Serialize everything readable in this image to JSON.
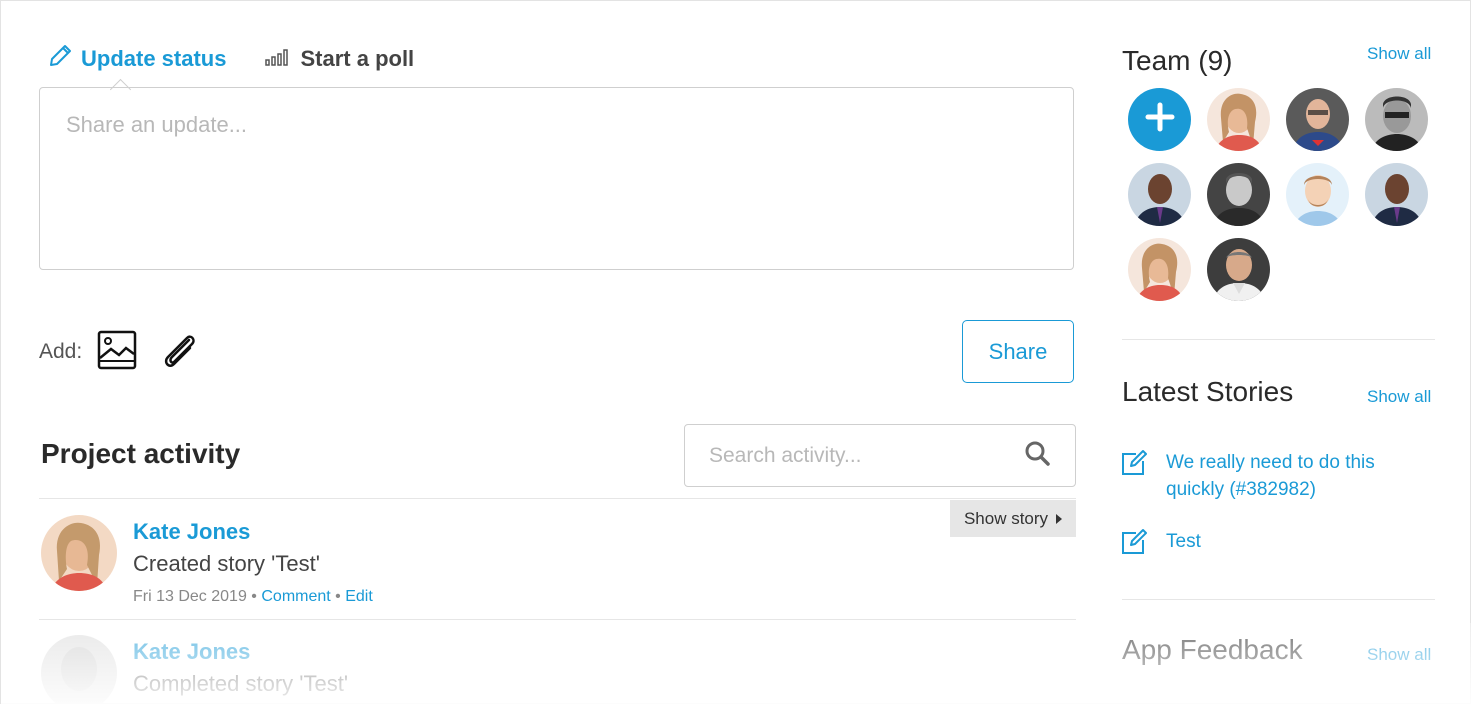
{
  "tabs": {
    "update_label": "Update status",
    "poll_label": "Start a poll"
  },
  "composer": {
    "placeholder": "Share an update...",
    "add_label": "Add:",
    "share_label": "Share"
  },
  "activity": {
    "title": "Project activity",
    "search_placeholder": "Search activity...",
    "items": [
      {
        "name": "Kate Jones",
        "text": "Created story 'Test'",
        "date": "Fri 13 Dec 2019",
        "separator": "•",
        "comment_label": "Comment",
        "edit_label": "Edit",
        "show_story_label": "Show story"
      },
      {
        "name": "Kate Jones",
        "text": "Completed story 'Test'"
      }
    ]
  },
  "team": {
    "title": "Team (9)",
    "show_all_label": "Show all"
  },
  "latest_stories": {
    "title": "Latest Stories",
    "show_all_label": "Show all",
    "items": [
      {
        "title": "We really need to do this quickly (#382982)"
      },
      {
        "title": "Test"
      }
    ]
  },
  "app_feedback": {
    "title": "App Feedback",
    "show_all_label": "Show all"
  },
  "colors": {
    "accent": "#1a9ad6",
    "border": "#cfcfcf"
  }
}
